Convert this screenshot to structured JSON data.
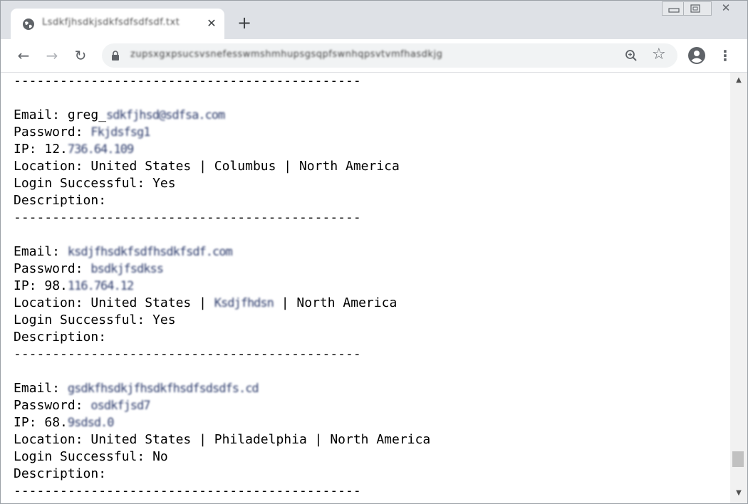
{
  "tab": {
    "title": "Lsdkfjhsdkjsdkfsdfsdfsdf.txt"
  },
  "toolbar": {
    "url": "zupsxgxpsucsvsnefesswmshmhupsgsqpfswnhqpsvtvmfhasdkjg"
  },
  "icons": {
    "back": "←",
    "forward": "→",
    "reload": "↻",
    "new_tab": "+",
    "close_tab": "✕",
    "zoom": "zoom-icon",
    "star": "☆",
    "profile": "profile-icon",
    "menu": "⋮",
    "minimize": "▭",
    "restore": "⧉",
    "close_window": "✕"
  },
  "content": {
    "separator": "---------------------------------------------",
    "entries": [
      {
        "email_label": "Email: ",
        "email_visible": "greg_",
        "email_redacted": "sdkfjhsd@sdfsa.com",
        "password_label": "Password: ",
        "password_redacted": "Fkjdsfsg1",
        "ip_label": "IP: ",
        "ip_visible": "12.",
        "ip_redacted": "736.64.109",
        "location": "Location: United States | Columbus | North America",
        "login": "Login Successful: Yes",
        "description": "Description:"
      },
      {
        "email_label": "Email: ",
        "email_visible": "",
        "email_redacted": "ksdjfhsdkfsdfhsdkfsdf.com",
        "password_label": "Password: ",
        "password_redacted": "bsdkjfsdkss",
        "ip_label": "IP: ",
        "ip_visible": "98.",
        "ip_redacted": "116.764.12",
        "location_prefix": "Location: United States | ",
        "location_redacted": "Ksdjfhdsn",
        "location_suffix": " | North America",
        "login": "Login Successful: Yes",
        "description": "Description:"
      },
      {
        "email_label": "Email: ",
        "email_visible": "",
        "email_redacted": "gsdkfhsdkjfhsdkfhsdfsdsdfs.cd",
        "password_label": "Password: ",
        "password_redacted": "osdkfjsd7",
        "ip_label": "IP: ",
        "ip_visible": "68.",
        "ip_redacted": "9sdsd.0",
        "location": "Location: United States | Philadelphia | North America",
        "login": "Login Successful: No",
        "description": "Description:"
      }
    ]
  }
}
